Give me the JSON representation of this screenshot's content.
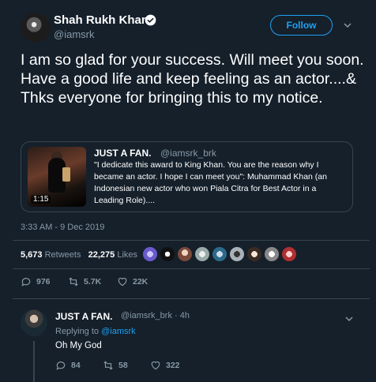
{
  "author": {
    "name": "Shah Rukh Khan",
    "handle": "@iamsrk",
    "follow_label": "Follow"
  },
  "tweet": {
    "text": "I am so glad for your success. Will meet you soon. Have a good life and keep feeling as an actor....& Thks everyone for bringing this to my notice.",
    "datetime": "3:33 AM - 9 Dec 2019"
  },
  "quote": {
    "name": "JUST A FAN.",
    "handle": "@iamsrk_brk",
    "text": "\"I dedicate this award to King Khan. You are the reason why I became an actor. I hope I can meet you\": Muhammad Khan (an Indonesian new actor who won Piala Citra for Best Actor in a Leading Role)....",
    "video_duration": "1:15"
  },
  "stats": {
    "retweets_count": "5,673",
    "retweets_label": "Retweets",
    "likes_count": "22,275",
    "likes_label": "Likes"
  },
  "actions": {
    "replies": "976",
    "retweets": "5.7K",
    "likes": "22K"
  },
  "reply": {
    "name": "JUST A FAN.",
    "handle_time": "@iamsrk_brk · 4h",
    "replying_prefix": "Replying to",
    "replying_to": "@iamsrk",
    "text": "Oh My God",
    "replies": "84",
    "retweets": "58",
    "likes": "322"
  },
  "colors": {
    "background": "#15202b",
    "accent": "#1da1f2",
    "muted": "#8899a6",
    "border": "#38444d"
  }
}
